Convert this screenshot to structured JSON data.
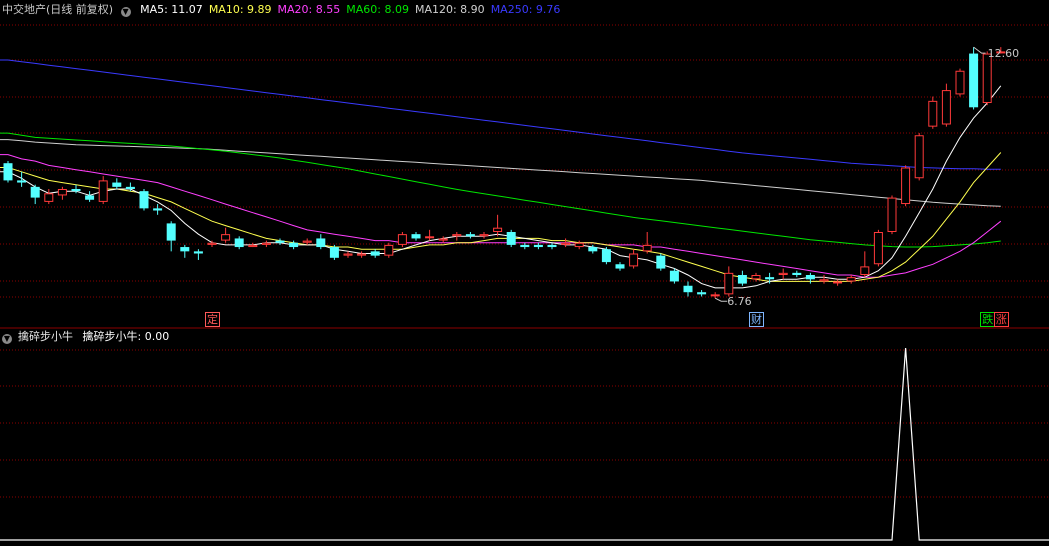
{
  "main_panel": {
    "stock_name": "中交地产",
    "period_label": "(日线 前复权)",
    "ma_labels": [
      {
        "text": "MA5: 11.07",
        "color": "#ffffff"
      },
      {
        "text": "MA10: 9.89",
        "color": "#ffff4f"
      },
      {
        "text": "MA20: 8.55",
        "color": "#ff40ff"
      },
      {
        "text": "MA60: 8.09",
        "color": "#00e600"
      },
      {
        "text": "MA120: 8.90",
        "color": "#cfcfcf"
      },
      {
        "text": "MA250: 9.76",
        "color": "#3a3aff"
      }
    ],
    "high_marker": "12.60",
    "low_marker": "6.76",
    "event_tags": [
      {
        "text": "定",
        "color": "#ff5a5a"
      },
      {
        "text": "财",
        "color": "#7fb6ff"
      },
      {
        "text": "跌",
        "color": "#00e600"
      },
      {
        "text": "涨",
        "color": "#ff4040"
      }
    ]
  },
  "indicator_panel": {
    "name": "擒碎步小牛",
    "value_label": "擒碎步小牛: 0.00"
  },
  "colors": {
    "up": "#ff3a3a",
    "down": "#54ffff",
    "grid": "#8b0000",
    "ma5": "#ffffff",
    "ma10": "#ffff4f",
    "ma20": "#ff40ff",
    "ma60": "#00e600",
    "ma120": "#cfcfcf",
    "ma250": "#3a3aff"
  },
  "chart_data": [
    {
      "type": "candlestick",
      "ylim": [
        6.3,
        13.3
      ],
      "candles": [
        [
          9.9,
          9.5,
          9.95,
          9.45
        ],
        [
          9.5,
          9.45,
          9.7,
          9.35
        ],
        [
          9.35,
          9.1,
          9.4,
          8.95
        ],
        [
          9.0,
          9.2,
          9.3,
          8.95
        ],
        [
          9.15,
          9.3,
          9.35,
          9.05
        ],
        [
          9.3,
          9.25,
          9.4,
          9.2
        ],
        [
          9.15,
          9.05,
          9.25,
          9.0
        ],
        [
          9.0,
          9.5,
          9.6,
          8.95
        ],
        [
          9.45,
          9.35,
          9.55,
          9.3
        ],
        [
          9.35,
          9.3,
          9.45,
          9.25
        ],
        [
          9.25,
          8.85,
          9.3,
          8.8
        ],
        [
          8.85,
          8.8,
          8.95,
          8.7
        ],
        [
          8.5,
          8.1,
          8.55,
          7.85
        ],
        [
          7.95,
          7.85,
          8.0,
          7.7
        ],
        [
          7.85,
          7.8,
          7.9,
          7.65
        ],
        [
          8.0,
          8.05,
          8.1,
          7.95
        ],
        [
          8.1,
          8.25,
          8.4,
          8.05
        ],
        [
          8.15,
          7.95,
          8.2,
          7.9
        ],
        [
          7.95,
          8.0,
          8.05,
          7.95
        ],
        [
          8.0,
          8.05,
          8.1,
          7.95
        ],
        [
          8.1,
          8.05,
          8.15,
          8.0
        ],
        [
          8.05,
          7.95,
          8.1,
          7.9
        ],
        [
          8.05,
          8.1,
          8.15,
          8.0
        ],
        [
          8.15,
          7.95,
          8.25,
          7.9
        ],
        [
          7.95,
          7.7,
          8.0,
          7.65
        ],
        [
          7.75,
          7.8,
          7.85,
          7.7
        ],
        [
          7.75,
          7.8,
          7.85,
          7.7
        ],
        [
          7.85,
          7.75,
          7.9,
          7.7
        ],
        [
          7.75,
          8.0,
          8.05,
          7.7
        ],
        [
          8.0,
          8.25,
          8.3,
          7.95
        ],
        [
          8.25,
          8.15,
          8.3,
          8.1
        ],
        [
          8.2,
          8.2,
          8.35,
          8.1
        ],
        [
          8.1,
          8.15,
          8.2,
          8.05
        ],
        [
          8.2,
          8.25,
          8.3,
          8.1
        ],
        [
          8.25,
          8.2,
          8.3,
          8.15
        ],
        [
          8.2,
          8.25,
          8.3,
          8.15
        ],
        [
          8.3,
          8.4,
          8.7,
          8.2
        ],
        [
          8.3,
          8.0,
          8.35,
          7.95
        ],
        [
          8.0,
          7.95,
          8.05,
          7.9
        ],
        [
          8.0,
          7.95,
          8.05,
          7.9
        ],
        [
          8.0,
          7.95,
          8.05,
          7.9
        ],
        [
          8.0,
          8.05,
          8.15,
          7.95
        ],
        [
          7.95,
          8.05,
          8.1,
          7.9
        ],
        [
          7.95,
          7.85,
          8.0,
          7.8
        ],
        [
          7.9,
          7.6,
          7.95,
          7.55
        ],
        [
          7.55,
          7.45,
          7.6,
          7.4
        ],
        [
          7.5,
          7.8,
          7.9,
          7.45
        ],
        [
          7.85,
          8.0,
          8.3,
          7.8
        ],
        [
          7.75,
          7.45,
          7.8,
          7.4
        ],
        [
          7.4,
          7.15,
          7.45,
          7.1
        ],
        [
          7.05,
          6.9,
          7.15,
          6.8
        ],
        [
          6.9,
          6.85,
          6.95,
          6.8
        ],
        [
          6.85,
          6.85,
          6.9,
          6.76
        ],
        [
          6.85,
          7.35,
          7.5,
          6.8
        ],
        [
          7.3,
          7.1,
          7.4,
          7.05
        ],
        [
          7.2,
          7.3,
          7.35,
          7.15
        ],
        [
          7.25,
          7.2,
          7.35,
          7.1
        ],
        [
          7.3,
          7.35,
          7.45,
          7.2
        ],
        [
          7.35,
          7.3,
          7.4,
          7.25
        ],
        [
          7.3,
          7.2,
          7.35,
          7.1
        ],
        [
          7.15,
          7.2,
          7.3,
          7.1
        ],
        [
          7.15,
          7.15,
          7.2,
          7.05
        ],
        [
          7.15,
          7.25,
          7.3,
          7.1
        ],
        [
          7.3,
          7.5,
          7.85,
          7.25
        ],
        [
          7.55,
          8.3,
          8.35,
          7.5
        ],
        [
          8.3,
          9.1,
          9.15,
          8.25
        ],
        [
          8.95,
          9.8,
          9.85,
          8.9
        ],
        [
          9.55,
          10.55,
          10.6,
          9.5
        ],
        [
          10.75,
          11.35,
          11.45,
          10.7
        ],
        [
          10.8,
          11.6,
          11.75,
          10.75
        ],
        [
          11.5,
          12.05,
          12.1,
          11.45
        ],
        [
          12.45,
          11.2,
          12.6,
          11.15
        ],
        [
          11.3,
          12.45,
          12.5,
          11.25
        ],
        [
          12.5,
          12.5,
          12.6,
          12.45
        ]
      ],
      "ma5": [
        9.7,
        9.55,
        9.35,
        9.2,
        9.25,
        9.25,
        9.15,
        9.25,
        9.3,
        9.3,
        9.15,
        9.0,
        8.8,
        8.5,
        8.25,
        8.05,
        8.0,
        8.0,
        8.0,
        8.05,
        8.05,
        8.0,
        8.0,
        8.0,
        7.9,
        7.85,
        7.8,
        7.8,
        7.8,
        7.9,
        8.0,
        8.1,
        8.15,
        8.2,
        8.2,
        8.2,
        8.25,
        8.2,
        8.15,
        8.1,
        8.05,
        8.0,
        8.0,
        7.95,
        7.9,
        7.75,
        7.7,
        7.65,
        7.55,
        7.45,
        7.3,
        7.1,
        7.0,
        7.0,
        7.0,
        7.05,
        7.15,
        7.2,
        7.2,
        7.25,
        7.25,
        7.2,
        7.2,
        7.25,
        7.4,
        7.7,
        8.2,
        8.75,
        9.3,
        9.95,
        10.5,
        10.95,
        11.3,
        11.7
      ],
      "ma10": [
        9.8,
        9.7,
        9.6,
        9.5,
        9.45,
        9.4,
        9.35,
        9.3,
        9.3,
        9.25,
        9.2,
        9.1,
        9.0,
        8.85,
        8.7,
        8.55,
        8.45,
        8.35,
        8.25,
        8.15,
        8.1,
        8.05,
        8.0,
        8.0,
        7.95,
        7.95,
        7.9,
        7.9,
        7.9,
        7.9,
        7.95,
        8.0,
        8.0,
        8.05,
        8.05,
        8.1,
        8.15,
        8.15,
        8.15,
        8.15,
        8.1,
        8.1,
        8.05,
        8.05,
        8.0,
        7.95,
        7.9,
        7.85,
        7.8,
        7.7,
        7.6,
        7.5,
        7.4,
        7.3,
        7.25,
        7.2,
        7.15,
        7.15,
        7.15,
        7.15,
        7.15,
        7.15,
        7.15,
        7.2,
        7.25,
        7.4,
        7.6,
        7.9,
        8.2,
        8.6,
        9.0,
        9.45,
        9.8,
        10.15
      ],
      "ma20": [
        10.1,
        10.0,
        9.95,
        9.85,
        9.8,
        9.75,
        9.7,
        9.65,
        9.6,
        9.55,
        9.5,
        9.45,
        9.35,
        9.25,
        9.15,
        9.05,
        8.95,
        8.85,
        8.75,
        8.65,
        8.55,
        8.45,
        8.35,
        8.3,
        8.25,
        8.2,
        8.15,
        8.1,
        8.1,
        8.05,
        8.05,
        8.05,
        8.05,
        8.05,
        8.05,
        8.05,
        8.05,
        8.05,
        8.05,
        8.05,
        8.05,
        8.05,
        8.05,
        8.05,
        8.0,
        8.0,
        8.0,
        7.95,
        7.95,
        7.9,
        7.85,
        7.8,
        7.75,
        7.7,
        7.65,
        7.6,
        7.55,
        7.5,
        7.45,
        7.4,
        7.35,
        7.3,
        7.3,
        7.25,
        7.25,
        7.3,
        7.35,
        7.45,
        7.55,
        7.7,
        7.85,
        8.05,
        8.3,
        8.55
      ],
      "ma60": [
        10.6,
        10.55,
        10.5,
        10.48,
        10.46,
        10.44,
        10.42,
        10.4,
        10.38,
        10.36,
        10.34,
        10.32,
        10.3,
        10.27,
        10.24,
        10.21,
        10.18,
        10.14,
        10.1,
        10.06,
        10.02,
        9.97,
        9.92,
        9.87,
        9.82,
        9.77,
        9.71,
        9.65,
        9.59,
        9.53,
        9.47,
        9.41,
        9.35,
        9.29,
        9.24,
        9.19,
        9.14,
        9.09,
        9.04,
        8.99,
        8.94,
        8.89,
        8.84,
        8.79,
        8.74,
        8.69,
        8.64,
        8.6,
        8.56,
        8.52,
        8.48,
        8.44,
        8.4,
        8.36,
        8.32,
        8.28,
        8.24,
        8.2,
        8.16,
        8.12,
        8.09,
        8.06,
        8.03,
        8.0,
        7.98,
        7.96,
        7.95,
        7.95,
        7.96,
        7.98,
        8.0,
        8.02,
        8.05,
        8.09
      ],
      "ma120": [
        10.45,
        10.42,
        10.39,
        10.37,
        10.35,
        10.33,
        10.32,
        10.31,
        10.3,
        10.29,
        10.28,
        10.27,
        10.26,
        10.25,
        10.24,
        10.22,
        10.2,
        10.18,
        10.16,
        10.14,
        10.12,
        10.1,
        10.08,
        10.06,
        10.04,
        10.02,
        10.0,
        9.98,
        9.96,
        9.94,
        9.92,
        9.9,
        9.88,
        9.86,
        9.84,
        9.82,
        9.8,
        9.78,
        9.76,
        9.74,
        9.72,
        9.7,
        9.68,
        9.66,
        9.64,
        9.62,
        9.6,
        9.58,
        9.56,
        9.54,
        9.52,
        9.5,
        9.47,
        9.44,
        9.41,
        9.38,
        9.35,
        9.32,
        9.29,
        9.26,
        9.23,
        9.2,
        9.17,
        9.14,
        9.11,
        9.08,
        9.05,
        9.02,
        8.99,
        8.97,
        8.95,
        8.93,
        8.91,
        8.9
      ],
      "ma250": [
        12.3,
        12.26,
        12.22,
        12.18,
        12.14,
        12.1,
        12.06,
        12.02,
        11.98,
        11.94,
        11.9,
        11.86,
        11.82,
        11.78,
        11.74,
        11.7,
        11.66,
        11.62,
        11.58,
        11.54,
        11.5,
        11.46,
        11.42,
        11.38,
        11.34,
        11.3,
        11.26,
        11.22,
        11.18,
        11.14,
        11.1,
        11.06,
        11.02,
        10.98,
        10.94,
        10.9,
        10.86,
        10.82,
        10.78,
        10.74,
        10.7,
        10.66,
        10.62,
        10.58,
        10.54,
        10.5,
        10.46,
        10.42,
        10.38,
        10.34,
        10.3,
        10.26,
        10.22,
        10.18,
        10.14,
        10.11,
        10.08,
        10.05,
        10.02,
        9.99,
        9.96,
        9.93,
        9.9,
        9.88,
        9.86,
        9.84,
        9.82,
        9.8,
        9.79,
        9.78,
        9.77,
        9.77,
        9.76,
        9.76
      ]
    },
    {
      "type": "line",
      "series": [
        {
          "name": "擒碎步小牛",
          "values": [
            0,
            0,
            0,
            0,
            0,
            0,
            0,
            0,
            0,
            0,
            0,
            0,
            0,
            0,
            0,
            0,
            0,
            0,
            0,
            0,
            0,
            0,
            0,
            0,
            0,
            0,
            0,
            0,
            0,
            0,
            0,
            0,
            0,
            0,
            0,
            0,
            0,
            0,
            0,
            0,
            0,
            0,
            0,
            0,
            0,
            0,
            0,
            0,
            0,
            0,
            0,
            0,
            0,
            0,
            0,
            0,
            0,
            0,
            0,
            0,
            0,
            0,
            0,
            0,
            0,
            0,
            1,
            0,
            0,
            0,
            0,
            0,
            0,
            0
          ]
        }
      ],
      "ylim": [
        0,
        1
      ]
    }
  ]
}
